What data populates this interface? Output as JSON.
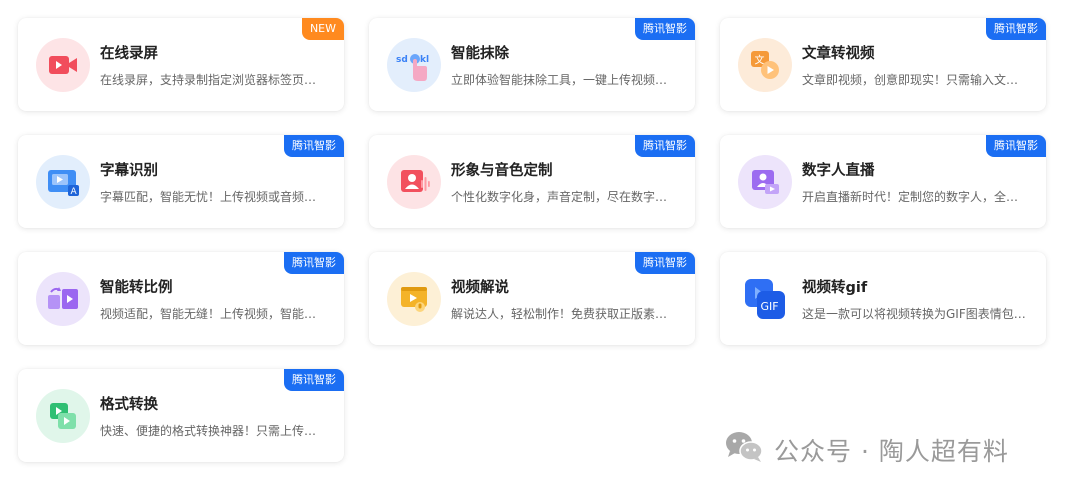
{
  "cards": [
    {
      "title": "在线录屏",
      "desc": "在线录屏，支持录制指定浏览器标签页、窗口或整个屏幕",
      "badge": "NEW",
      "icon": "screen-record-icon",
      "colors": {
        "bg": "#fde4e6",
        "fg": "#f14d5c"
      }
    },
    {
      "title": "智能抹除",
      "desc": "立即体验智能抹除工具，一键上传视频，快速去除字幕和水印",
      "badge": "腾讯智影",
      "icon": "smart-erase-icon",
      "colors": {
        "bg": "#e3eefc",
        "fg": "#3b82f6"
      }
    },
    {
      "title": "文章转视频",
      "desc": "文章即视频，创意即现实！只需输入文章链接或文字",
      "badge": "腾讯智影",
      "icon": "article-to-video-icon",
      "colors": {
        "bg": "#fdebd9",
        "fg": "#f59a3a"
      }
    },
    {
      "title": "字幕识别",
      "desc": "字幕匹配，智能无忧！上传视频或音频，自动识别字幕",
      "badge": "腾讯智影",
      "icon": "subtitle-recognition-icon",
      "colors": {
        "bg": "#e2eefc",
        "fg": "#3f8ef5"
      }
    },
    {
      "title": "形象与音色定制",
      "desc": "个性化数字化身，声音定制，尽在数字人形象与音色定制",
      "badge": "腾讯智影",
      "icon": "avatar-voice-custom-icon",
      "colors": {
        "bg": "#fde3e5",
        "fg": "#f2505e"
      }
    },
    {
      "title": "数字人直播",
      "desc": "开启直播新时代！定制您的数字人，全天候直播",
      "badge": "腾讯智影",
      "icon": "digital-human-live-icon",
      "colors": {
        "bg": "#ede4fb",
        "fg": "#9c6cf0"
      }
    },
    {
      "title": "智能转比例",
      "desc": "视频适配，智能无缝！上传视频，智能转换画面比例",
      "badge": "腾讯智影",
      "icon": "smart-ratio-icon",
      "colors": {
        "bg": "#ece4fb",
        "fg": "#9b66f0"
      }
    },
    {
      "title": "视频解说",
      "desc": "解说达人，轻松制作！免费获取正版素材，一键生成解说",
      "badge": "腾讯智影",
      "icon": "video-narration-icon",
      "colors": {
        "bg": "#fdf0d6",
        "fg": "#f4b329"
      }
    },
    {
      "title": "视频转gif",
      "desc": "这是一款可以将视频转换为GIF图表情包的在线工具",
      "badge": "",
      "icon": "video-to-gif-icon",
      "colors": {
        "bg": "#ffffff",
        "fg": "#2f6ff4"
      }
    },
    {
      "title": "格式转换",
      "desc": "快速、便捷的格式转换神器！只需上传文件即可转换",
      "badge": "腾讯智影",
      "icon": "format-convert-icon",
      "colors": {
        "bg": "#e0f6ea",
        "fg": "#2fbf73"
      }
    }
  ],
  "watermark": {
    "text": "公众号 · 陶人超有料",
    "icon": "wechat-icon"
  }
}
